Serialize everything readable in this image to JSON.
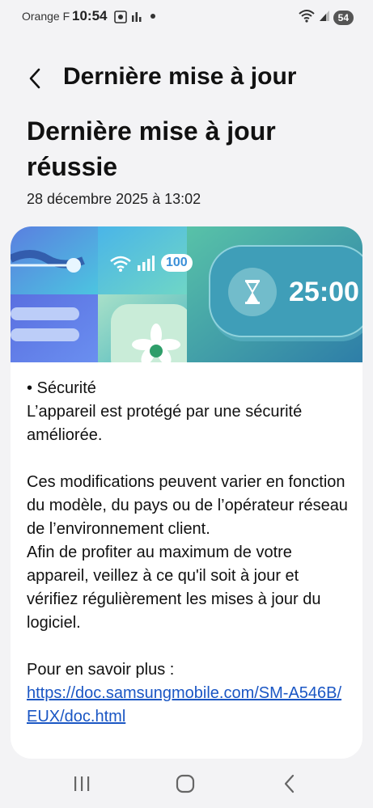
{
  "status_bar": {
    "carrier": "Orange F",
    "time": "10:54",
    "battery": "54",
    "icons": [
      "screenshot-icon",
      "signal-bars-icon",
      "dot-icon",
      "wifi-icon",
      "cell-signal-icon",
      "battery-icon"
    ]
  },
  "header": {
    "title": "Dernière mise à jour",
    "back_icon": "chevron-left-icon"
  },
  "main": {
    "heading": "Dernière mise à jour réussie",
    "date": "28 décembre 2025 à 13:02"
  },
  "banner": {
    "battery_text": "100",
    "timer_text": "25:00",
    "icons": [
      "wifi-icon",
      "signal-bars-icon",
      "hourglass-icon",
      "flower-app-icon"
    ]
  },
  "content": {
    "bullet": "• Sécurité",
    "bullet_desc": "L’appareil est protégé par une sécurité améliorée.",
    "para1": "Ces modifications peuvent varier en fonction du modèle, du pays ou de l’opérateur réseau de l’environnement client.",
    "para2": "Afin de profiter au maximum de votre appareil, veillez à ce qu'il soit à jour et vérifiez régulièrement les mises à jour du logiciel.",
    "more_label": "Pour en savoir plus :",
    "link": "https://doc.samsungmobile.com/SM-A546B/EUX/doc.html"
  },
  "navbar": {
    "icons": [
      "recents-icon",
      "home-icon",
      "back-icon"
    ]
  },
  "colors": {
    "background": "#f3f3f5",
    "card": "#ffffff",
    "link": "#1a56c4",
    "banner_blue": "#4a8fd8",
    "banner_teal": "#3a9e9a"
  }
}
